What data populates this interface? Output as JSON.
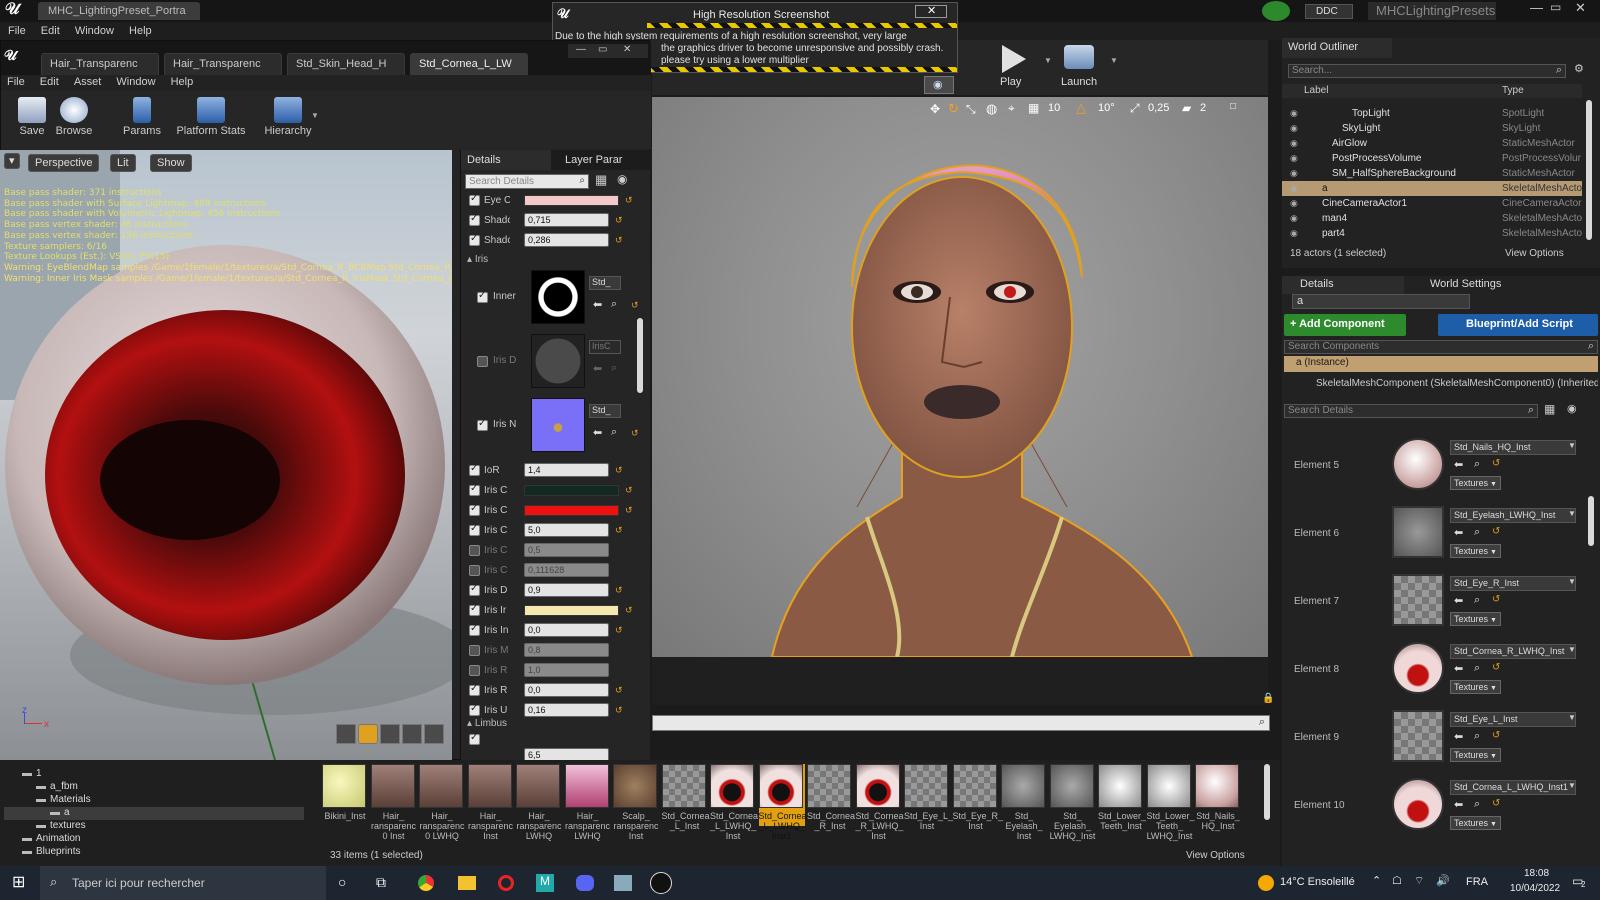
{
  "app": {
    "window_title": "MHC_LightingPreset_Portra",
    "project_name": "MHCLightingPresets",
    "ddc_label": "DDC",
    "menu": [
      "File",
      "Edit",
      "Window",
      "Help"
    ]
  },
  "material_editor": {
    "tabs": [
      "Hair_Transparenc",
      "Hair_Transparenc",
      "Std_Skin_Head_H",
      "Std_Cornea_L_LW"
    ],
    "menu": [
      "File",
      "Edit",
      "Asset",
      "Window",
      "Help"
    ],
    "toolbar": [
      "Save",
      "Browse",
      "Params",
      "Platform Stats",
      "Hierarchy"
    ],
    "viewport_buttons": {
      "perspective": "Perspective",
      "lit": "Lit",
      "show": "Show"
    },
    "stats": [
      "Base pass shader: 371 instructions",
      "Base pass shader with Surface Lightmap: 409 instructions",
      "Base pass shader with Volumetric Lightmap: 456 instructions",
      "Base pass vertex shader: 46 instructions",
      "Base pass vertex shader: 158 instructions",
      "Texture samplers: 6/16",
      "Texture Lookups (Est.): VS(0), PS(15)",
      "Warning: EyeBlendMap samples /Game/1female/1/textures/a/Std_Cornea_R_BCBMap.Std_Cornea_R_BCBM",
      "Warning: Inner Iris Mask samples /Game/1female/1/textures/a/Std_Cornea_R_IrisMask.Std_Cornea_R_IrisMa"
    ],
    "details": {
      "tab_details": "Details",
      "tab_layer": "Layer Parar",
      "search_placeholder": "Search Details",
      "rows_top": [
        {
          "name": "Eye C",
          "type": "color",
          "color": "#f4c8c8",
          "on": true
        },
        {
          "name": "Shadc",
          "type": "num",
          "value": "0,715",
          "on": true
        },
        {
          "name": "Shadc",
          "type": "num",
          "value": "0,286",
          "on": true
        }
      ],
      "section_iris": "Iris",
      "texture_rows": [
        {
          "name": "Inner",
          "select": "Std_",
          "on": true
        },
        {
          "name": "Iris D",
          "select": "IrisC",
          "on": false
        },
        {
          "name": "Iris N",
          "select": "Std_",
          "on": true
        }
      ],
      "rows_bottom": [
        {
          "name": "IoR",
          "type": "num",
          "value": "1,4",
          "on": true
        },
        {
          "name": "Iris C",
          "type": "color",
          "color": "#132a22",
          "on": true
        },
        {
          "name": "Iris C",
          "type": "color",
          "color": "#ee1111",
          "on": true
        },
        {
          "name": "Iris C",
          "type": "num",
          "value": "5,0",
          "on": true
        },
        {
          "name": "Iris C",
          "type": "num",
          "value": "0,5",
          "on": false
        },
        {
          "name": "Iris C",
          "type": "num",
          "value": "0,111628",
          "on": false
        },
        {
          "name": "Iris D",
          "type": "num",
          "value": "0,9",
          "on": true
        },
        {
          "name": "Iris Ir",
          "type": "color",
          "color": "#f5e7b0",
          "on": true
        },
        {
          "name": "Iris In",
          "type": "num",
          "value": "0,0",
          "on": true
        },
        {
          "name": "Iris M",
          "type": "num",
          "value": "0,8",
          "on": false
        },
        {
          "name": "Iris R",
          "type": "num",
          "value": "1,0",
          "on": false
        },
        {
          "name": "Iris R",
          "type": "num",
          "value": "0,0",
          "on": true
        },
        {
          "name": "Iris U",
          "type": "num",
          "value": "0,16",
          "on": true
        }
      ],
      "section_limbus": "Limbus",
      "limbus_value": "6,5"
    }
  },
  "hires_dialog": {
    "title": "High Resolution Screenshot",
    "message": [
      "Due to the high system requirements of a high resolution screenshot, very large",
      "the graphics driver to become unresponsive and possibly crash.",
      "please try using a lower multiplier"
    ]
  },
  "main_toolbar": {
    "play": "Play",
    "launch": "Launch"
  },
  "viewport_controls": {
    "grid": "10",
    "angle": "10°",
    "scale": "0,25",
    "cam": "2"
  },
  "world_outliner": {
    "tab": "World Outliner",
    "search_placeholder": "Search...",
    "col_label": "Label",
    "col_type": "Type",
    "rows": [
      {
        "label": "TopLight",
        "type": "SpotLight",
        "indent": 5
      },
      {
        "label": "SkyLight",
        "type": "SkyLight",
        "indent": 4
      },
      {
        "label": "AirGlow",
        "type": "StaticMeshActor",
        "indent": 3
      },
      {
        "label": "PostProcessVolume",
        "type": "PostProcessVolur",
        "indent": 3
      },
      {
        "label": "SM_HalfSphereBackground",
        "type": "StaticMeshActor",
        "indent": 3
      },
      {
        "label": "a",
        "type": "SkeletalMeshActo",
        "indent": 2,
        "selected": true
      },
      {
        "label": "CineCameraActor1",
        "type": "CineCameraActor",
        "indent": 2
      },
      {
        "label": "man4",
        "type": "SkeletalMeshActo",
        "indent": 2
      },
      {
        "label": "part4",
        "type": "SkeletalMeshActo",
        "indent": 2
      }
    ],
    "status": "18 actors (1 selected)",
    "view_options": "View Options"
  },
  "details_panel": {
    "tab": "Details",
    "tab_world": "World Settings",
    "name_value": "a",
    "add_component": "+ Add Component",
    "blueprint": "Blueprint/Add Script",
    "search_components": "Search Components",
    "instance": "a (Instance)",
    "component": "SkeletalMeshComponent (SkeletalMeshComponent0) (Inherited",
    "search_details": "Search Details",
    "elements": [
      {
        "label": "Element 5",
        "mat": "Std_Nails_HQ_Inst",
        "thumb": "nails"
      },
      {
        "label": "Element 6",
        "mat": "Std_Eyelash_LWHQ_Inst",
        "thumb": "lash"
      },
      {
        "label": "Element 7",
        "mat": "Std_Eye_R_Inst",
        "thumb": "checker"
      },
      {
        "label": "Element 8",
        "mat": "Std_Cornea_R_LWHQ_Inst",
        "thumb": "cornea"
      },
      {
        "label": "Element 9",
        "mat": "Std_Eye_L_Inst",
        "thumb": "checker"
      },
      {
        "label": "Element 10",
        "mat": "Std_Cornea_L_LWHQ_Inst1",
        "thumb": "cornea"
      }
    ],
    "textures_label": "Textures"
  },
  "content_browser": {
    "tree": [
      {
        "label": "1",
        "indent": 1
      },
      {
        "label": "a_fbm",
        "indent": 2
      },
      {
        "label": "Materials",
        "indent": 2
      },
      {
        "label": "a",
        "indent": 3,
        "selected": true
      },
      {
        "label": "textures",
        "indent": 2
      },
      {
        "label": "Animation",
        "indent": 1
      },
      {
        "label": "Blueprints",
        "indent": 1
      }
    ],
    "assets": [
      {
        "name": "Bikini_Inst",
        "kind": "yellow"
      },
      {
        "name": "Hair_ ransparenc 0 Inst",
        "kind": "hair"
      },
      {
        "name": "Hair_ ransparenc 0 LWHQ",
        "kind": "hair"
      },
      {
        "name": "Hair_ ransparenc Inst",
        "kind": "hair"
      },
      {
        "name": "Hair_ ransparenc LWHQ",
        "kind": "hair"
      },
      {
        "name": "Hair_ ransparenc LWHQ",
        "kind": "hairpink"
      },
      {
        "name": "Scalp_ ransparenc Inst",
        "kind": "scalp"
      },
      {
        "name": "Std_Cornea _L_Inst",
        "kind": "checker"
      },
      {
        "name": "Std_Cornea _L_LWHQ_ Inst",
        "kind": "cornea"
      },
      {
        "name": "Std_Cornea _L_LWHQ_ Inst1",
        "kind": "cornea",
        "selected": true
      },
      {
        "name": "Std_Cornea _R_Inst",
        "kind": "checker"
      },
      {
        "name": "Std_Cornea _R_LWHQ_ Inst",
        "kind": "cornea"
      },
      {
        "name": "Std_Eye_L_ Inst",
        "kind": "checker"
      },
      {
        "name": "Std_Eye_R_ Inst",
        "kind": "checker"
      },
      {
        "name": "Std_ Eyelash_ Inst",
        "kind": "lash"
      },
      {
        "name": "Std_ Eyelash_ LWHQ_Inst",
        "kind": "lash"
      },
      {
        "name": "Std_Lower_ Teeth_Inst",
        "kind": "teeth"
      },
      {
        "name": "Std_Lower_ Teeth_ LWHQ_Inst",
        "kind": "teeth"
      },
      {
        "name": "Std_Nails_ HQ_Inst",
        "kind": "nails"
      }
    ],
    "status": "33 items (1 selected)",
    "view_options": "View Options"
  },
  "taskbar": {
    "search_placeholder": "Taper ici pour rechercher",
    "weather": "14°C Ensoleillé",
    "lang": "FRA",
    "time": "18:08",
    "date": "10/04/2022",
    "notif": "2"
  }
}
